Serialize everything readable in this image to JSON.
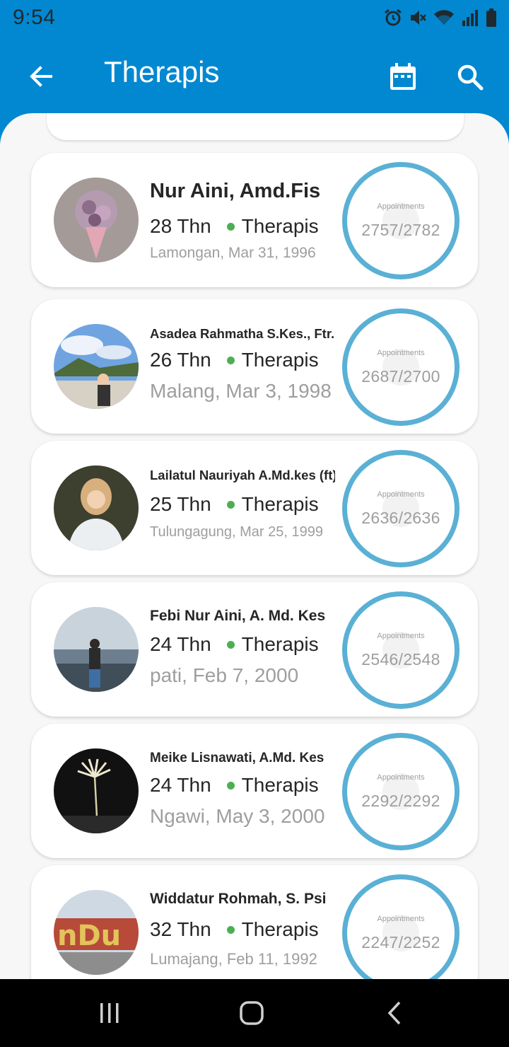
{
  "status_bar": {
    "time": "9:54",
    "icons": [
      "alarm-icon",
      "mute-icon",
      "wifi-icon",
      "signal-icon",
      "battery-icon"
    ]
  },
  "app_bar": {
    "title": "Therapis",
    "actions": [
      "calendar-icon",
      "search-icon"
    ],
    "color": "#0288d1"
  },
  "therapists": [
    {
      "name": "Nur Aini, Amd.Fis",
      "age": "28 Thn",
      "role": "Therapis",
      "origin": "Lamongan, Mar 31, 1996",
      "appointments_label": "Appointments",
      "appointments": "2757/2782"
    },
    {
      "name": "Asadea Rahmatha S.Kes., Ftr.",
      "age": "26 Thn",
      "role": "Therapis",
      "origin": "Malang, Mar 3, 1998",
      "appointments_label": "Appointments",
      "appointments": "2687/2700"
    },
    {
      "name": "Lailatul Nauriyah A.Md.kes (ft)",
      "age": "25 Thn",
      "role": "Therapis",
      "origin": "Tulungagung, Mar 25, 1999",
      "appointments_label": "Appointments",
      "appointments": "2636/2636"
    },
    {
      "name": "Febi Nur Aini, A. Md. Kes",
      "age": "24 Thn",
      "role": "Therapis",
      "origin": "pati, Feb 7, 2000",
      "appointments_label": "Appointments",
      "appointments": "2546/2548"
    },
    {
      "name": "Meike Lisnawati, A.Md. Kes",
      "age": "24 Thn",
      "role": "Therapis",
      "origin": "Ngawi, May 3, 2000",
      "appointments_label": "Appointments",
      "appointments": "2292/2292"
    },
    {
      "name": "Widdatur Rohmah, S. Psi",
      "age": "32 Thn",
      "role": "Therapis",
      "origin": "Lumajang, Feb 11, 1992",
      "appointments_label": "Appointments",
      "appointments": "2247/2252"
    }
  ],
  "colors": {
    "status_dot": "#4caf50",
    "ring": "#5ab0d5",
    "muted_text": "#9e9e9e"
  },
  "nav_bar": {
    "buttons": [
      "recent-apps-icon",
      "home-icon",
      "back-icon"
    ]
  }
}
